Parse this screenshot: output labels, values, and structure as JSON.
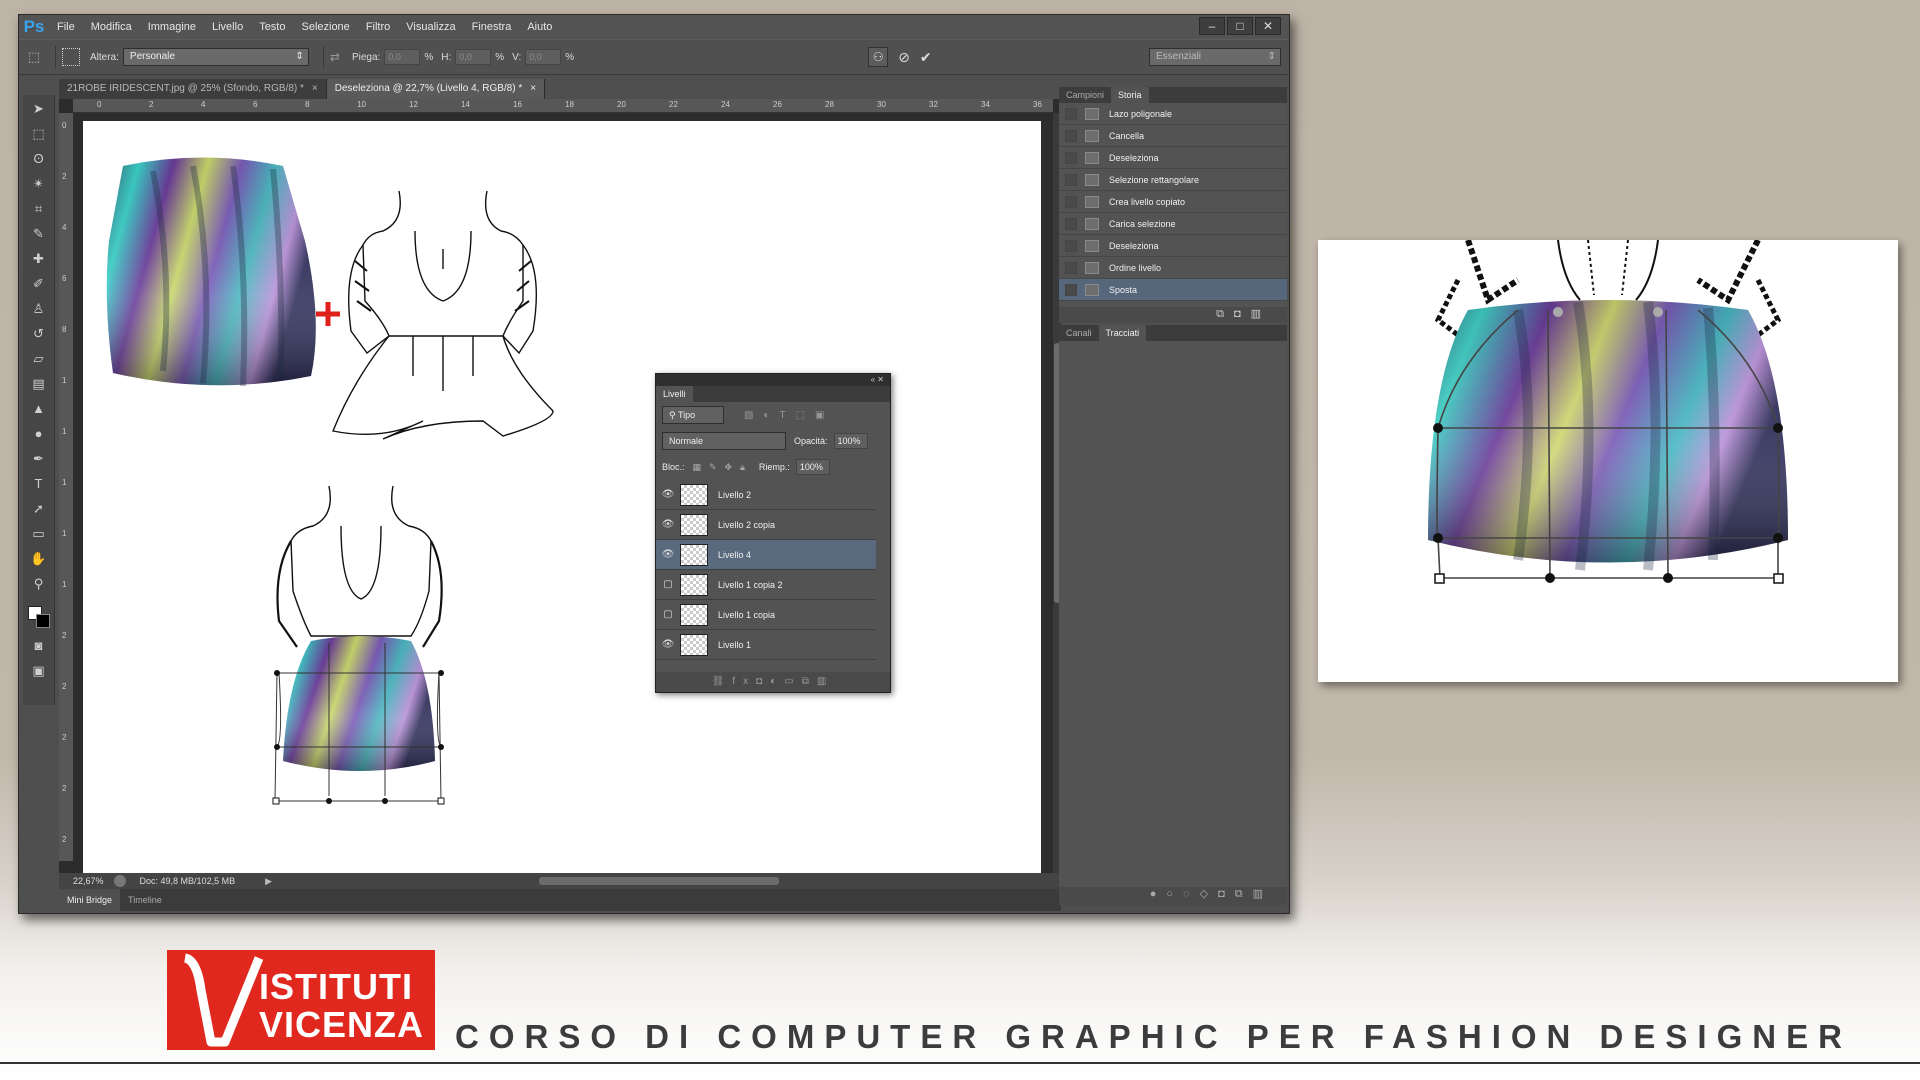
{
  "menubar": {
    "logo": "Ps",
    "items": [
      "File",
      "Modifica",
      "Immagine",
      "Livello",
      "Testo",
      "Selezione",
      "Filtro",
      "Visualizza",
      "Finestra",
      "Aiuto"
    ]
  },
  "window_controls": {
    "minimize": "–",
    "maximize": "□",
    "close": "✕"
  },
  "options": {
    "warp_label": "Altera:",
    "warp_value": "Personale",
    "bend_label": "Piega:",
    "bend_value": "0,0",
    "h_label": "H:",
    "h_value": "0,0",
    "v_label": "V:",
    "v_value": "0,0",
    "percent": "%",
    "workspace": "Essenziali"
  },
  "tabs": [
    {
      "label": "21ROBE IRIDESCENT.jpg @ 25% (Sfondo, RGB/8) *",
      "close": "×"
    },
    {
      "label": "Deseleziona @ 22,7% (Livello 4, RGB/8) *",
      "close": "×"
    }
  ],
  "ruler_top": [
    "0",
    "2",
    "4",
    "6",
    "8",
    "10",
    "12",
    "14",
    "16",
    "18",
    "20",
    "22",
    "24",
    "26",
    "28",
    "30",
    "32",
    "34",
    "36"
  ],
  "ruler_left": [
    "0",
    "2",
    "4",
    "6",
    "8",
    "1",
    "1",
    "1",
    "1",
    "1",
    "2",
    "2",
    "2",
    "2",
    "2",
    "3"
  ],
  "status": {
    "zoom": "22,67%",
    "doc": "Doc: 49,8 MB/102,5 MB"
  },
  "bottom_tabs": [
    "Mini Bridge",
    "Timeline"
  ],
  "history": {
    "tabs": [
      "Campioni",
      "Storia"
    ],
    "items": [
      "Lazo poligonale",
      "Cancella",
      "Deseleziona",
      "Selezione rettangolare",
      "Crea livello copiato",
      "Carica selezione",
      "Deseleziona",
      "Ordine livello",
      "Sposta"
    ]
  },
  "paths_panel": {
    "tabs": [
      "Canali",
      "Tracciati"
    ]
  },
  "layers": {
    "tab": "Livelli",
    "filter": "Tipo",
    "blend_mode": "Normale",
    "opacity_label": "Opacità:",
    "opacity": "100%",
    "lock_label": "Bloc.:",
    "fill_label": "Riemp.:",
    "fill": "100%",
    "items": [
      {
        "name": "Livello 2",
        "visible": true
      },
      {
        "name": "Livello 2 copia",
        "visible": true
      },
      {
        "name": "Livello 4",
        "visible": true
      },
      {
        "name": "Livello 1 copia 2",
        "visible": false
      },
      {
        "name": "Livello 1 copia",
        "visible": false
      },
      {
        "name": "Livello 1",
        "visible": true
      }
    ]
  },
  "branding": {
    "logo_line1": "ISTITUTI",
    "logo_line2": "VICENZA",
    "course": "CORSO DI COMPUTER GRAPHIC PER FASHION DESIGNER"
  },
  "colors": {
    "logo_red": "#e0281e",
    "selection_blue": "#56677c",
    "plus_red": "#e0201a"
  }
}
